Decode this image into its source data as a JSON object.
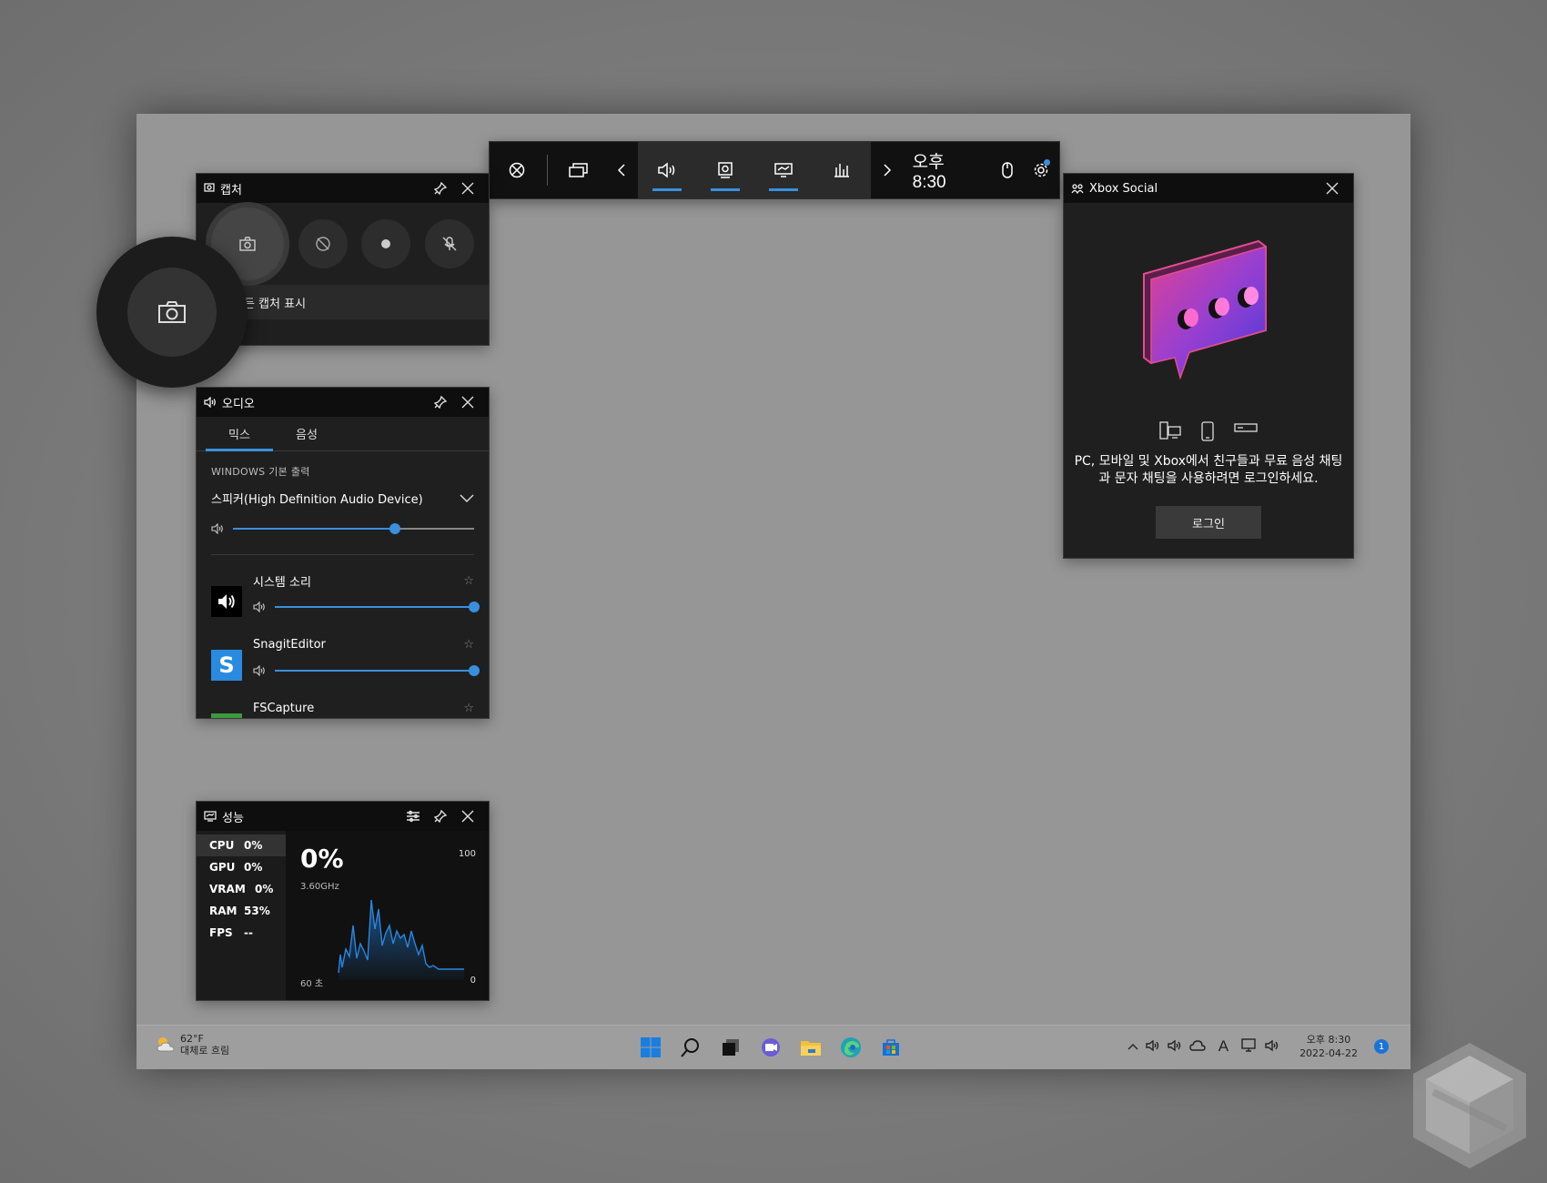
{
  "topbar": {
    "clock": "오후 8:30"
  },
  "capture": {
    "title": "캡처",
    "show_all_captures": "모든 캡처 표시"
  },
  "audio": {
    "title": "오디오",
    "tabs": [
      "믹스",
      "음성"
    ],
    "section_label": "WINDOWS 기본 출력",
    "device": "스피커(High Definition Audio Device)",
    "master_volume": 0.67,
    "apps": [
      {
        "name": "시스템 소리",
        "volume": 1.0
      },
      {
        "name": "SnagitEditor",
        "volume": 1.0
      },
      {
        "name": "FSCapture"
      }
    ]
  },
  "performance": {
    "title": "성능",
    "metrics": [
      {
        "key": "CPU",
        "value": "0%"
      },
      {
        "key": "GPU",
        "value": "0%"
      },
      {
        "key": "VRAM",
        "value": "0%"
      },
      {
        "key": "RAM",
        "value": "53%"
      },
      {
        "key": "FPS",
        "value": "--"
      }
    ],
    "current": "0%",
    "frequency": "3.60GHz",
    "y_max": "100",
    "y_min": "0",
    "x_span": "60 초"
  },
  "social": {
    "title": "Xbox Social",
    "message": "PC, 모바일 및 Xbox에서 친구들과 무료 음성 채팅과 문자 채팅을 사용하려면 로그인하세요.",
    "login": "로그인"
  },
  "taskbar": {
    "temp": "62°F",
    "weather": "대체로 흐림",
    "time": "오후 8:30",
    "date": "2022-04-22",
    "notifications": "1"
  },
  "colors": {
    "accent": "#3a8fdc",
    "panel": "#1f1f1f",
    "header": "#0e0e0e"
  }
}
